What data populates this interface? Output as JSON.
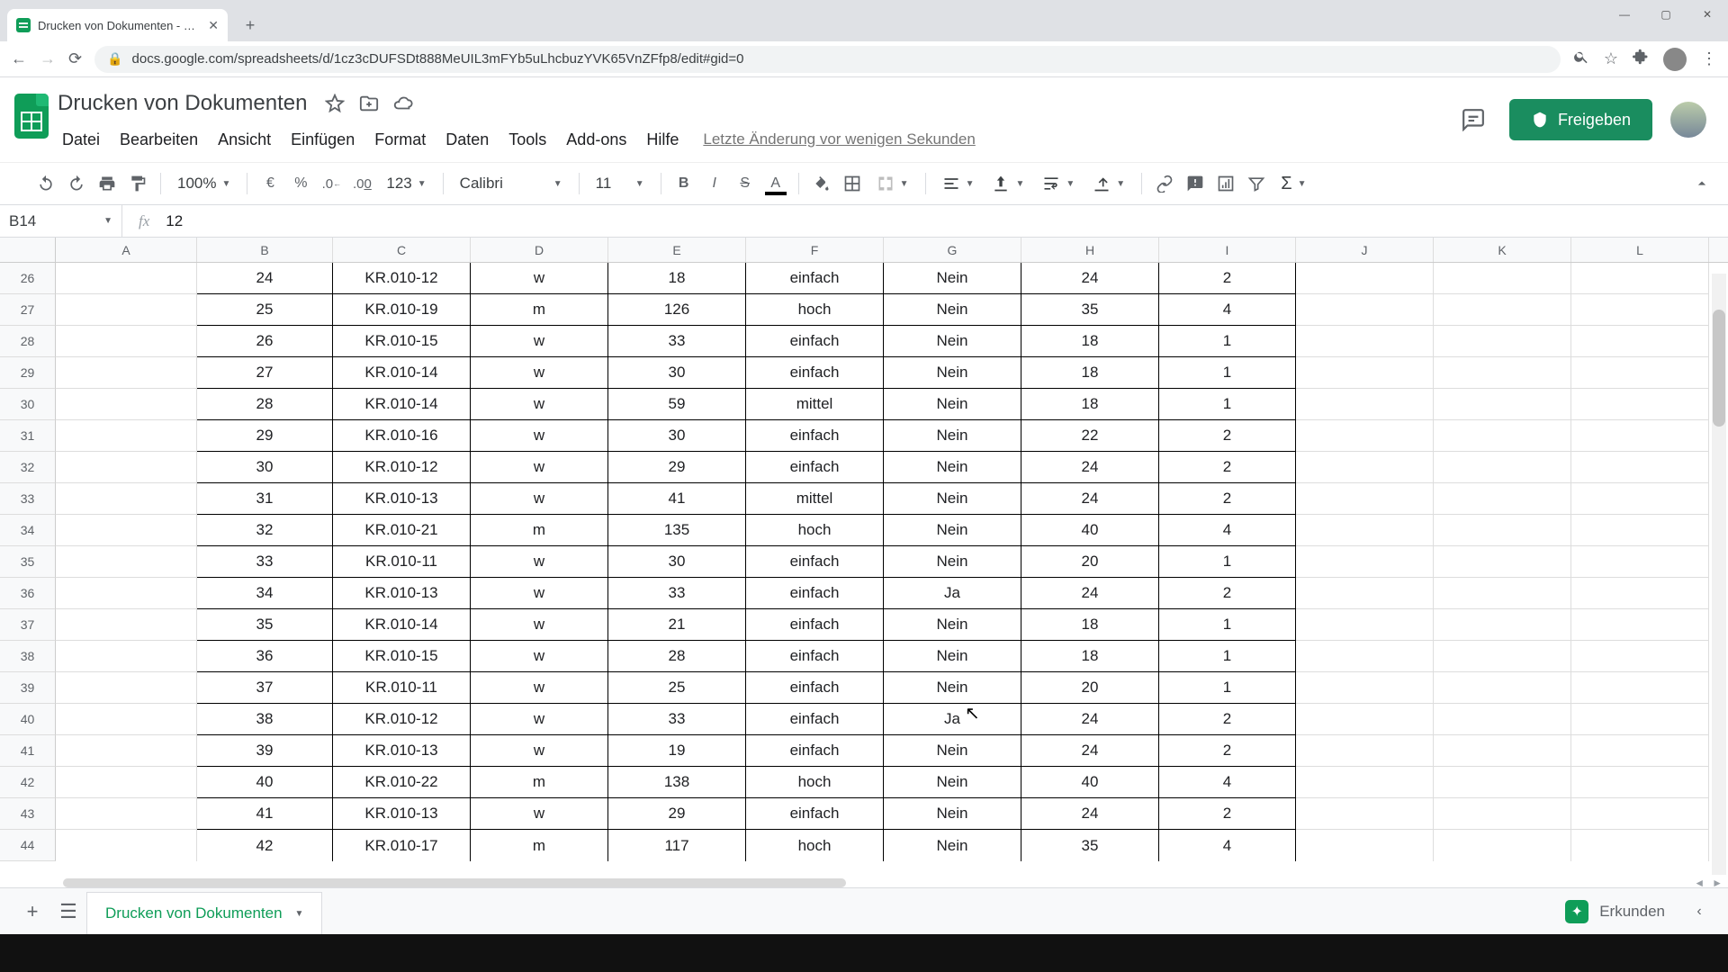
{
  "browser": {
    "tab_title": "Drucken von Dokumenten - Goo…",
    "url": "docs.google.com/spreadsheets/d/1cz3cDUFSDt888MeUIL3mFYb5uLhcbuzYVK65VnZFfp8/edit#gid=0"
  },
  "doc": {
    "title": "Drucken von Dokumenten",
    "last_edit": "Letzte Änderung vor wenigen Sekunden",
    "share_label": "Freigeben"
  },
  "menus": [
    "Datei",
    "Bearbeiten",
    "Ansicht",
    "Einfügen",
    "Format",
    "Daten",
    "Tools",
    "Add-ons",
    "Hilfe"
  ],
  "toolbar": {
    "zoom": "100%",
    "currency": "€",
    "percent": "%",
    "dec_less": ".0",
    "dec_more": ".00",
    "numfmt": "123",
    "font": "Calibri",
    "size": "11"
  },
  "cellref": {
    "name": "B14",
    "fx": "fx",
    "value": "12"
  },
  "columns": [
    "A",
    "B",
    "C",
    "D",
    "E",
    "F",
    "G",
    "H",
    "I",
    "J",
    "K",
    "L"
  ],
  "row_nums": [
    26,
    27,
    28,
    29,
    30,
    31,
    32,
    33,
    34,
    35,
    36,
    37,
    38,
    39,
    40,
    41,
    42,
    43,
    44
  ],
  "rows": [
    {
      "B": "24",
      "C": "KR.010-12",
      "D": "w",
      "E": "18",
      "F": "einfach",
      "G": "Nein",
      "H": "24",
      "I": "2"
    },
    {
      "B": "25",
      "C": "KR.010-19",
      "D": "m",
      "E": "126",
      "F": "hoch",
      "G": "Nein",
      "H": "35",
      "I": "4"
    },
    {
      "B": "26",
      "C": "KR.010-15",
      "D": "w",
      "E": "33",
      "F": "einfach",
      "G": "Nein",
      "H": "18",
      "I": "1"
    },
    {
      "B": "27",
      "C": "KR.010-14",
      "D": "w",
      "E": "30",
      "F": "einfach",
      "G": "Nein",
      "H": "18",
      "I": "1"
    },
    {
      "B": "28",
      "C": "KR.010-14",
      "D": "w",
      "E": "59",
      "F": "mittel",
      "G": "Nein",
      "H": "18",
      "I": "1"
    },
    {
      "B": "29",
      "C": "KR.010-16",
      "D": "w",
      "E": "30",
      "F": "einfach",
      "G": "Nein",
      "H": "22",
      "I": "2"
    },
    {
      "B": "30",
      "C": "KR.010-12",
      "D": "w",
      "E": "29",
      "F": "einfach",
      "G": "Nein",
      "H": "24",
      "I": "2"
    },
    {
      "B": "31",
      "C": "KR.010-13",
      "D": "w",
      "E": "41",
      "F": "mittel",
      "G": "Nein",
      "H": "24",
      "I": "2"
    },
    {
      "B": "32",
      "C": "KR.010-21",
      "D": "m",
      "E": "135",
      "F": "hoch",
      "G": "Nein",
      "H": "40",
      "I": "4"
    },
    {
      "B": "33",
      "C": "KR.010-11",
      "D": "w",
      "E": "30",
      "F": "einfach",
      "G": "Nein",
      "H": "20",
      "I": "1"
    },
    {
      "B": "34",
      "C": "KR.010-13",
      "D": "w",
      "E": "33",
      "F": "einfach",
      "G": "Ja",
      "H": "24",
      "I": "2"
    },
    {
      "B": "35",
      "C": "KR.010-14",
      "D": "w",
      "E": "21",
      "F": "einfach",
      "G": "Nein",
      "H": "18",
      "I": "1"
    },
    {
      "B": "36",
      "C": "KR.010-15",
      "D": "w",
      "E": "28",
      "F": "einfach",
      "G": "Nein",
      "H": "18",
      "I": "1"
    },
    {
      "B": "37",
      "C": "KR.010-11",
      "D": "w",
      "E": "25",
      "F": "einfach",
      "G": "Nein",
      "H": "20",
      "I": "1"
    },
    {
      "B": "38",
      "C": "KR.010-12",
      "D": "w",
      "E": "33",
      "F": "einfach",
      "G": "Ja",
      "H": "24",
      "I": "2"
    },
    {
      "B": "39",
      "C": "KR.010-13",
      "D": "w",
      "E": "19",
      "F": "einfach",
      "G": "Nein",
      "H": "24",
      "I": "2"
    },
    {
      "B": "40",
      "C": "KR.010-22",
      "D": "m",
      "E": "138",
      "F": "hoch",
      "G": "Nein",
      "H": "40",
      "I": "4"
    },
    {
      "B": "41",
      "C": "KR.010-13",
      "D": "w",
      "E": "29",
      "F": "einfach",
      "G": "Nein",
      "H": "24",
      "I": "2"
    },
    {
      "B": "42",
      "C": "KR.010-17",
      "D": "m",
      "E": "117",
      "F": "hoch",
      "G": "Nein",
      "H": "35",
      "I": "4"
    }
  ],
  "sheetbar": {
    "tab": "Drucken von Dokumenten",
    "explore": "Erkunden"
  }
}
